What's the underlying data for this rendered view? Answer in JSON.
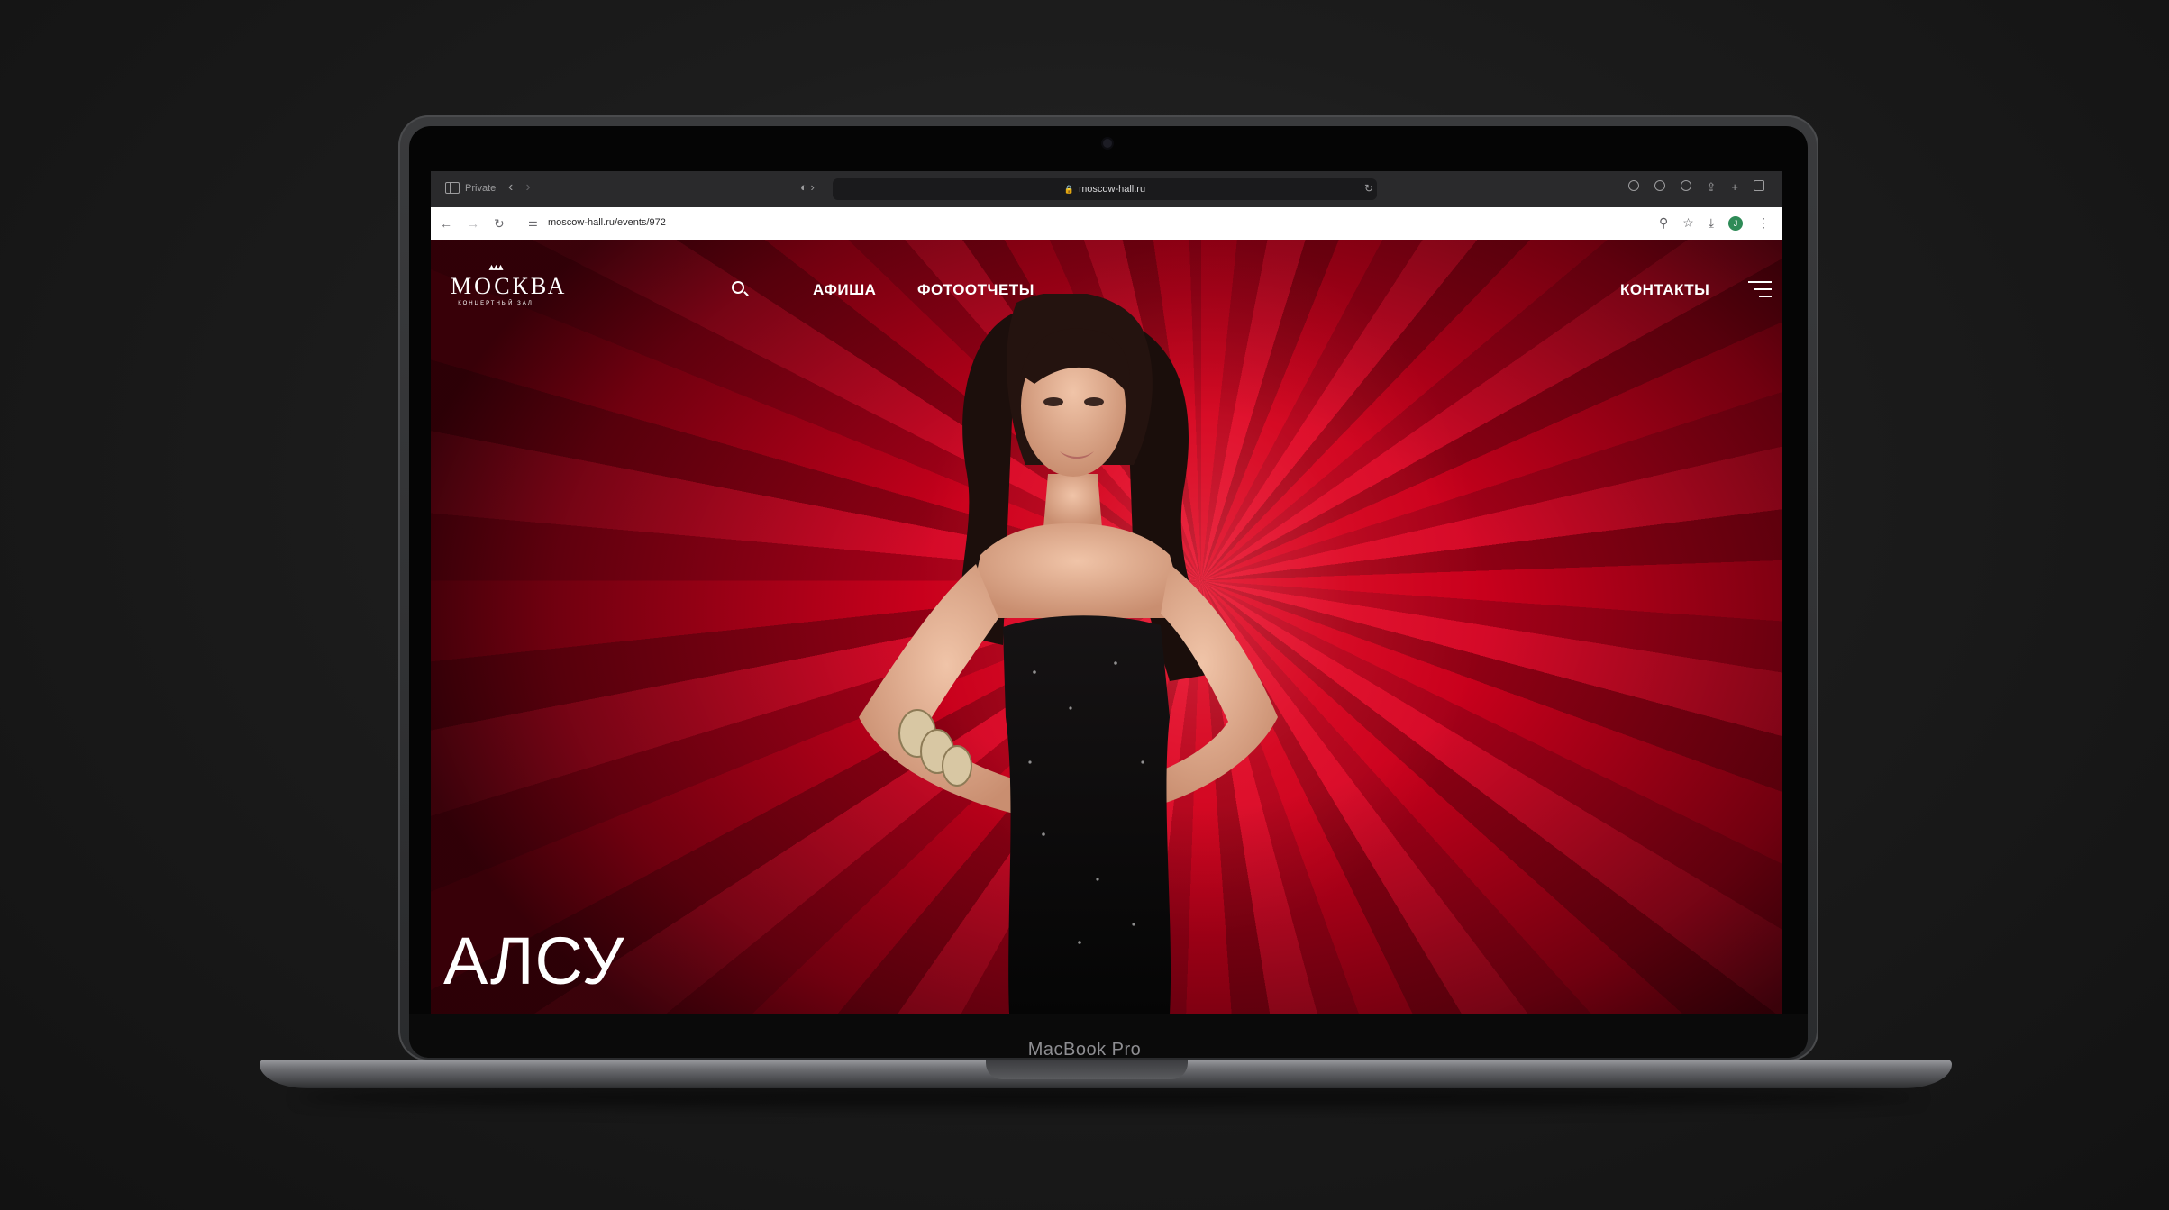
{
  "browser": {
    "safari_private_label": "Private",
    "safari_url": "moscow-hall.ru",
    "chrome_url": "moscow-hall.ru/events/972",
    "avatar_letter": "J"
  },
  "site": {
    "logo_word": "МОСКВА",
    "logo_sub": "КОНЦЕРТНЫЙ ЗАЛ",
    "nav": [
      "АФИША",
      "ФОТООТЧЕТЫ"
    ],
    "nav_right": "КОНТАКТЫ",
    "hero_title": "АЛСУ",
    "accent_color": "#c8001c"
  },
  "device": {
    "label": "MacBook Pro"
  }
}
